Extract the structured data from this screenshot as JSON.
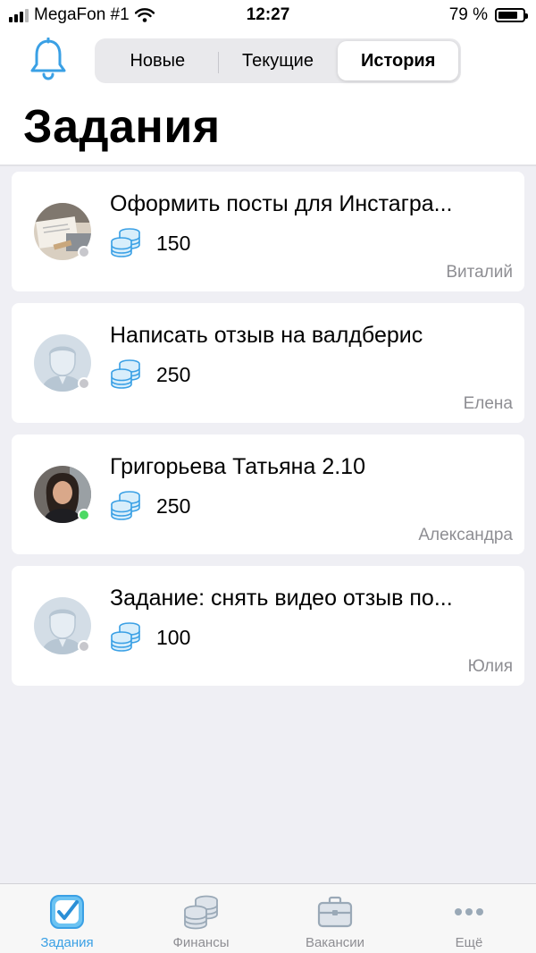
{
  "status_bar": {
    "carrier": "MegaFon #1",
    "time": "12:27",
    "battery": "79 %",
    "battery_level": 0.79
  },
  "header": {
    "bell_icon": "bell-icon",
    "segments": [
      {
        "label": "Новые",
        "active": false
      },
      {
        "label": "Текущие",
        "active": false
      },
      {
        "label": "История",
        "active": true
      }
    ],
    "title": "Задания"
  },
  "tasks": [
    {
      "title": "Оформить посты для Инстагра...",
      "amount": "150",
      "author": "Виталий",
      "online": false,
      "avatar": "photo-laptop"
    },
    {
      "title": "Написать отзыв на валдберис",
      "amount": "250",
      "author": "Елена",
      "online": false,
      "avatar": "placeholder-person"
    },
    {
      "title": "Григорьева Татьяна 2.10",
      "amount": "250",
      "author": "Александра",
      "online": true,
      "avatar": "photo-woman"
    },
    {
      "title": "Задание: снять видео отзыв по...",
      "amount": "100",
      "author": "Юлия",
      "online": false,
      "avatar": "placeholder-person"
    }
  ],
  "tabbar": {
    "items": [
      {
        "label": "Задания",
        "icon": "checkbox-icon",
        "active": true
      },
      {
        "label": "Финансы",
        "icon": "coins-icon",
        "active": false
      },
      {
        "label": "Вакансии",
        "icon": "briefcase-icon",
        "active": false
      },
      {
        "label": "Ещё",
        "icon": "more-icon",
        "active": false
      }
    ]
  },
  "colors": {
    "accent": "#3aa0e5",
    "background": "#efeff4",
    "card": "#ffffff",
    "secondary_text": "#8e8e93",
    "online": "#4cd964"
  }
}
